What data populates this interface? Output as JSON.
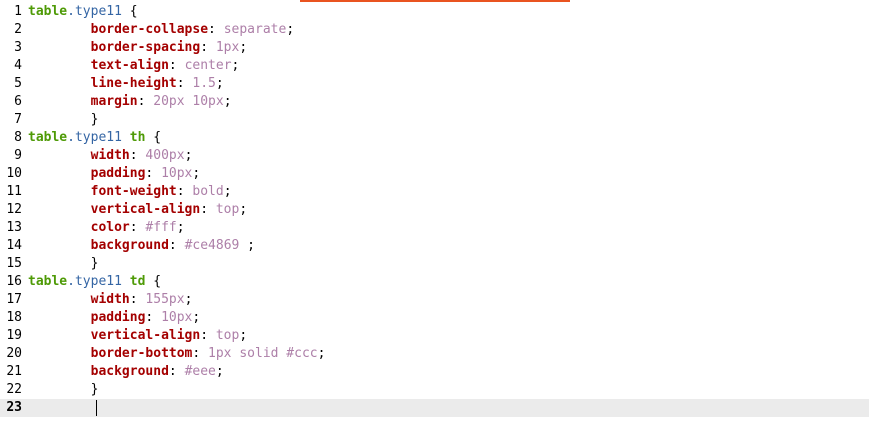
{
  "lines": [
    {
      "num": "1",
      "indent": "",
      "tag": "table",
      "cls": ".type11",
      "sel2": "",
      "prop": "",
      "val": "",
      "text": " {"
    },
    {
      "num": "2",
      "indent": "        ",
      "prop": "border-collapse",
      "val": "separate",
      "end": ";"
    },
    {
      "num": "3",
      "indent": "        ",
      "prop": "border-spacing",
      "val": "1px",
      "end": ";"
    },
    {
      "num": "4",
      "indent": "        ",
      "prop": "text-align",
      "val": "center",
      "end": ";"
    },
    {
      "num": "5",
      "indent": "        ",
      "prop": "line-height",
      "val": "1.5",
      "end": ";"
    },
    {
      "num": "6",
      "indent": "        ",
      "prop": "margin",
      "val": "20px 10px",
      "end": ";"
    },
    {
      "num": "7",
      "indent": "        ",
      "brace": "}"
    },
    {
      "num": "8",
      "tag": "table",
      "cls": ".type11",
      "sel2": "th",
      "text": " {"
    },
    {
      "num": "9",
      "indent": "        ",
      "prop": "width",
      "val": "400px",
      "end": ";"
    },
    {
      "num": "10",
      "indent": "        ",
      "prop": "padding",
      "val": "10px",
      "end": ";"
    },
    {
      "num": "11",
      "indent": "        ",
      "prop": "font-weight",
      "val": "bold",
      "end": ";"
    },
    {
      "num": "12",
      "indent": "        ",
      "prop": "vertical-align",
      "val": "top",
      "end": ";"
    },
    {
      "num": "13",
      "indent": "        ",
      "prop": "color",
      "val": "#fff",
      "end": ";"
    },
    {
      "num": "14",
      "indent": "        ",
      "prop": "background",
      "val": "#ce4869",
      "end": " ;"
    },
    {
      "num": "15",
      "indent": "        ",
      "brace": "}"
    },
    {
      "num": "16",
      "tag": "table",
      "cls": ".type11",
      "sel2": "td",
      "text": " {"
    },
    {
      "num": "17",
      "indent": "        ",
      "prop": "width",
      "val": "155px",
      "end": ";"
    },
    {
      "num": "18",
      "indent": "        ",
      "prop": "padding",
      "val": "10px",
      "end": ";"
    },
    {
      "num": "19",
      "indent": "        ",
      "prop": "vertical-align",
      "val": "top",
      "end": ";"
    },
    {
      "num": "20",
      "indent": "        ",
      "prop": "border-bottom",
      "val": "1px solid #ccc",
      "end": ";"
    },
    {
      "num": "21",
      "indent": "        ",
      "prop": "background",
      "val": "#eee",
      "end": ";"
    },
    {
      "num": "22",
      "indent": "        ",
      "brace": "}"
    },
    {
      "num": "23",
      "indent": "",
      "current": true
    }
  ]
}
